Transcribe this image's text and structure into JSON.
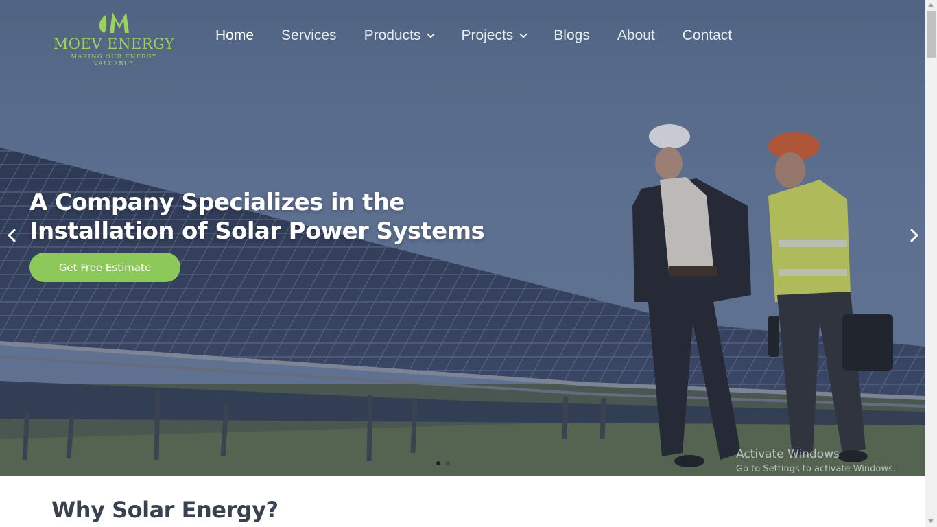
{
  "brand": {
    "name": "MOEV ENERGY",
    "tagline": "MAKING OUR ENERGY VALUABLE",
    "accent_color": "#9bd35a",
    "logo_icon": "leaf-m-logo-icon"
  },
  "nav": {
    "items": [
      {
        "label": "Home",
        "active": true,
        "dropdown": false
      },
      {
        "label": "Services",
        "active": false,
        "dropdown": false
      },
      {
        "label": "Products",
        "active": false,
        "dropdown": true
      },
      {
        "label": "Projects",
        "active": false,
        "dropdown": true
      },
      {
        "label": "Blogs",
        "active": false,
        "dropdown": false
      },
      {
        "label": "About",
        "active": false,
        "dropdown": false
      },
      {
        "label": "Contact",
        "active": false,
        "dropdown": false
      }
    ]
  },
  "hero": {
    "headline_line1": "A Company Specializes in the",
    "headline_line2": "Installation of Solar Power Systems",
    "cta_label": "Get Free Estimate",
    "cta_color": "#8dc85a",
    "prev_icon": "chevron-left-icon",
    "next_icon": "chevron-right-icon",
    "slide_count": 2,
    "active_slide": 1
  },
  "watermark": {
    "title": "Activate Windows",
    "subtitle": "Go to Settings to activate Windows."
  },
  "section": {
    "title": "Why Solar Energy?"
  }
}
